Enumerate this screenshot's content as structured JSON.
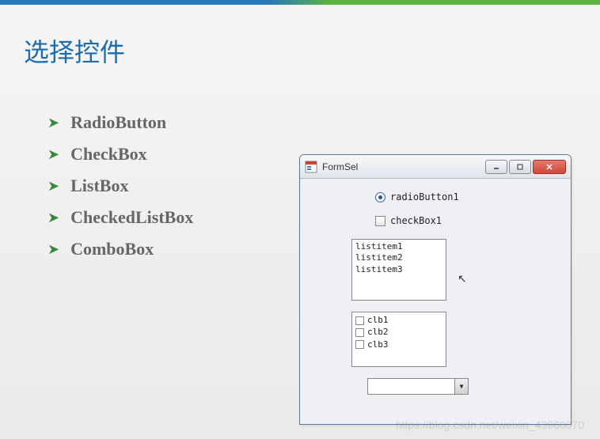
{
  "page": {
    "title": "选择控件"
  },
  "bullets": {
    "items": [
      "RadioButton",
      "CheckBox",
      "ListBox",
      "CheckedListBox",
      "ComboBox"
    ]
  },
  "form": {
    "title": "FormSel",
    "radio_label": "radioButton1",
    "checkbox_label": "checkBox1",
    "listbox_items": [
      "listitem1",
      "listitem2",
      "listitem3"
    ],
    "checkedlistbox_items": [
      "clb1",
      "clb2",
      "clb3"
    ],
    "combobox_value": ""
  },
  "watermark": "https://blog.csdn.net/weixin_43960070"
}
